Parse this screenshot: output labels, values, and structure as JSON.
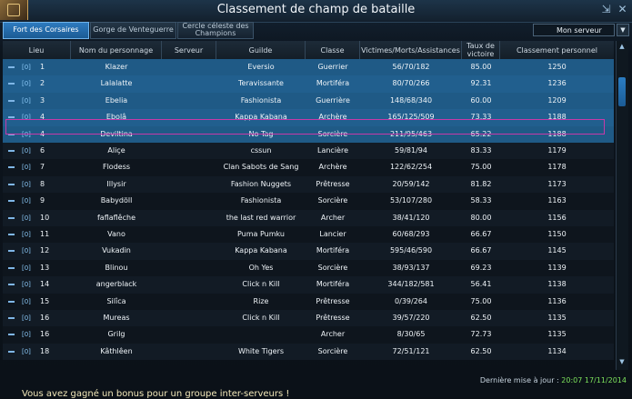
{
  "window": {
    "title": "Classement de champ de bataille"
  },
  "tabs": [
    {
      "label": "Fort des Corsaires",
      "active": true
    },
    {
      "label": "Gorge de Venteguerre",
      "active": false
    },
    {
      "label": "Cercle céleste des Champions",
      "active": false
    }
  ],
  "server_select": {
    "value": "Mon serveur"
  },
  "columns": [
    "Lieu",
    "Nom du personnage",
    "Serveur",
    "Guilde",
    "Classe",
    "Victimes/Morts/Assistances",
    "Taux de victoire",
    "Classement personnel"
  ],
  "rows": [
    {
      "rank": "1",
      "name": "Klazer",
      "server": "",
      "guild": "Eversio",
      "cls": "Guerrier",
      "kda": "56/70/182",
      "winrate": "85.00",
      "rating": "1250",
      "tier": "[0]"
    },
    {
      "rank": "2",
      "name": "Lalalatte",
      "server": "",
      "guild": "Teravissante",
      "cls": "Mortiféra",
      "kda": "80/70/266",
      "winrate": "92.31",
      "rating": "1236",
      "tier": "[0]"
    },
    {
      "rank": "3",
      "name": "Ebelia",
      "server": "",
      "guild": "Fashionista",
      "cls": "Guerrière",
      "kda": "148/68/340",
      "winrate": "60.00",
      "rating": "1209",
      "tier": "[0]"
    },
    {
      "rank": "4",
      "name": "Ebolâ",
      "server": "",
      "guild": "Kappa Kabana",
      "cls": "Archère",
      "kda": "165/125/509",
      "winrate": "73.33",
      "rating": "1188",
      "tier": "[0]"
    },
    {
      "rank": "4",
      "name": "Deviltina",
      "server": "",
      "guild": "No Tag",
      "cls": "Sorcière",
      "kda": "211/95/463",
      "winrate": "65.22",
      "rating": "1188",
      "tier": "[0]"
    },
    {
      "rank": "6",
      "name": "Aliçe",
      "server": "",
      "guild": "cssun",
      "cls": "Lancière",
      "kda": "59/81/94",
      "winrate": "83.33",
      "rating": "1179",
      "tier": "[0]"
    },
    {
      "rank": "7",
      "name": "Flodess",
      "server": "",
      "guild": "Clan Sabots de Sang",
      "cls": "Archère",
      "kda": "122/62/254",
      "winrate": "75.00",
      "rating": "1178",
      "tier": "[0]"
    },
    {
      "rank": "8",
      "name": "Illysir",
      "server": "",
      "guild": "Fashion Nuggets",
      "cls": "Prêtresse",
      "kda": "20/59/142",
      "winrate": "81.82",
      "rating": "1173",
      "tier": "[0]"
    },
    {
      "rank": "9",
      "name": "Babydöll",
      "server": "",
      "guild": "Fashionista",
      "cls": "Sorcière",
      "kda": "53/107/280",
      "winrate": "58.33",
      "rating": "1163",
      "tier": "[0]"
    },
    {
      "rank": "10",
      "name": "faflaflêche",
      "server": "",
      "guild": "the last red warrior",
      "cls": "Archer",
      "kda": "38/41/120",
      "winrate": "80.00",
      "rating": "1156",
      "tier": "[0]"
    },
    {
      "rank": "11",
      "name": "Vano",
      "server": "",
      "guild": "Puma Pumku",
      "cls": "Lancier",
      "kda": "60/68/293",
      "winrate": "66.67",
      "rating": "1150",
      "tier": "[0]"
    },
    {
      "rank": "12",
      "name": "Vukadin",
      "server": "",
      "guild": "Kappa Kabana",
      "cls": "Mortiféra",
      "kda": "595/46/590",
      "winrate": "66.67",
      "rating": "1145",
      "tier": "[0]"
    },
    {
      "rank": "13",
      "name": "Blinou",
      "server": "",
      "guild": "Oh Yes",
      "cls": "Sorcière",
      "kda": "38/93/137",
      "winrate": "69.23",
      "rating": "1139",
      "tier": "[0]"
    },
    {
      "rank": "14",
      "name": "angerblack",
      "server": "",
      "guild": "Click n Kill",
      "cls": "Mortiféra",
      "kda": "344/182/581",
      "winrate": "56.41",
      "rating": "1138",
      "tier": "[0]"
    },
    {
      "rank": "15",
      "name": "Silîca",
      "server": "",
      "guild": "Rize",
      "cls": "Prêtresse",
      "kda": "0/39/264",
      "winrate": "75.00",
      "rating": "1136",
      "tier": "[0]"
    },
    {
      "rank": "16",
      "name": "Mureas",
      "server": "",
      "guild": "Click n Kill",
      "cls": "Prêtresse",
      "kda": "39/57/220",
      "winrate": "62.50",
      "rating": "1135",
      "tier": "[0]"
    },
    {
      "rank": "16",
      "name": "Grilg",
      "server": "",
      "guild": "",
      "cls": "Archer",
      "kda": "8/30/65",
      "winrate": "72.73",
      "rating": "1135",
      "tier": "[0]"
    },
    {
      "rank": "18",
      "name": "Kâthlêen",
      "server": "",
      "guild": "White Tigers",
      "cls": "Sorcière",
      "kda": "72/51/121",
      "winrate": "62.50",
      "rating": "1134",
      "tier": "[0]"
    }
  ],
  "footer": {
    "label": "Dernière mise à jour :",
    "value": "20:07 17/11/2014"
  },
  "chat": {
    "text": "Vous avez gagné un bonus pour un groupe inter-serveurs !"
  }
}
